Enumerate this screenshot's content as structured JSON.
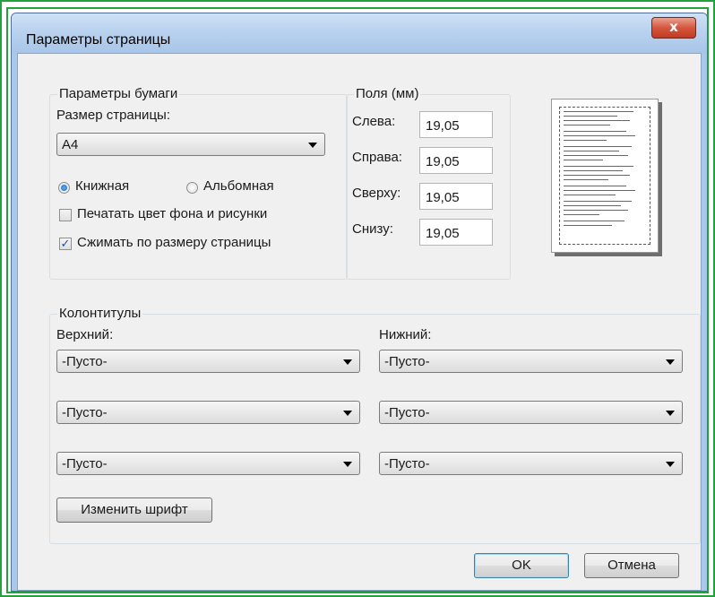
{
  "window": {
    "title": "Параметры страницы",
    "close_glyph": "x"
  },
  "paper": {
    "group_label": "Параметры бумаги",
    "size_label": "Размер страницы:",
    "size_value": "A4",
    "portrait_label": "Книжная",
    "landscape_label": "Альбомная",
    "orientation_selected": "portrait",
    "print_bg_label": "Печатать цвет фона и рисунки",
    "print_bg_checked": false,
    "shrink_label": "Сжимать по размеру страницы",
    "shrink_checked": true
  },
  "margins": {
    "group_label": "Поля (мм)",
    "left_label": "Слева:",
    "left_value": "19,05",
    "right_label": "Справа:",
    "right_value": "19,05",
    "top_label": "Сверху:",
    "top_value": "19,05",
    "bottom_label": "Снизу:",
    "bottom_value": "19,05"
  },
  "headers_footers": {
    "group_label": "Колонтитулы",
    "header_label": "Верхний:",
    "footer_label": "Нижний:",
    "header_values": [
      "-Пусто-",
      "-Пусто-",
      "-Пусто-"
    ],
    "footer_values": [
      "-Пусто-",
      "-Пусто-",
      "-Пусто-"
    ],
    "font_button": "Изменить шрифт"
  },
  "buttons": {
    "ok": "OK",
    "cancel": "Отмена"
  },
  "colors": {
    "accent_frame": "#22a23a",
    "titlebar": "#b9d2ef",
    "close": "#c13b22"
  },
  "icons": [
    "close-icon",
    "dropdown-arrow-icon",
    "radio-icon",
    "checkbox-icon",
    "page-preview-icon"
  ]
}
